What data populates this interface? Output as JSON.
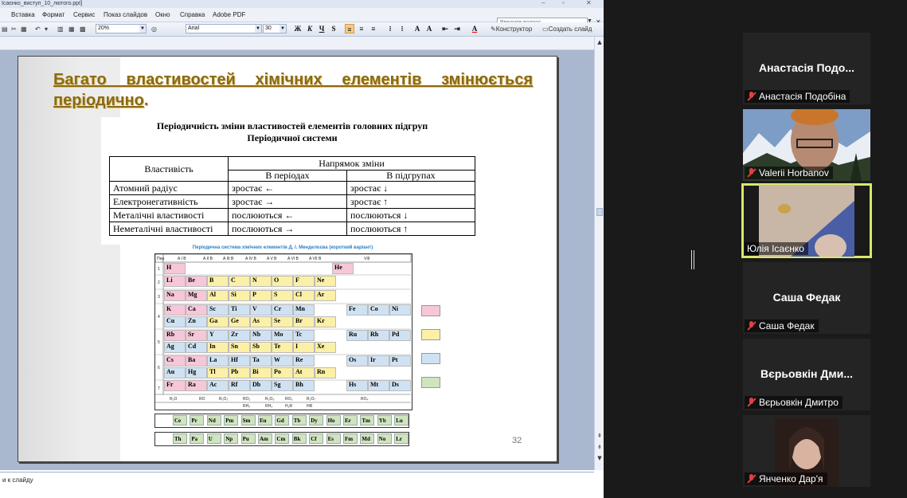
{
  "app": {
    "window_title": "Ісаєнко_виступ_10_лютого.ppt]",
    "menu": [
      "Вставка",
      "Формат",
      "Сервис",
      "Показ слайдов",
      "Окно",
      "Справка",
      "Adobe PDF"
    ],
    "help_placeholder": "Введите вопрос",
    "zoom": "20%",
    "font": "Arial",
    "font_size": "30",
    "constructor_label": "Конструктор",
    "new_slide_label": "Создать слайд",
    "notes_text": "и к слайду"
  },
  "slide": {
    "title_part1": "Багато властивостей хімічних елементів ",
    "title_part2": "змінюється періодично",
    "title_end": ".",
    "table_title_line1": "Періодичність зміни властивостей елементів головних підгруп",
    "table_title_line2": "Періодичної системи",
    "table": {
      "header_property": "Властивість",
      "header_direction": "Напрямок зміни",
      "header_periods": "В періодах",
      "header_groups": "В підгрупах",
      "rows": [
        {
          "property": "Атомний радіус",
          "periods": "зростає ←",
          "groups": "зростає ↓"
        },
        {
          "property": "Електронегативність",
          "periods": "зростає →",
          "groups": "зростає ↑"
        },
        {
          "property": "Металічні властивості",
          "periods": "послюються ←",
          "groups": "послюються ↓"
        },
        {
          "property": "Неметалічні властивості",
          "periods": "послюються →",
          "groups": "послюються ↑"
        }
      ]
    },
    "periodic_title": "Періодична система хімічних елементів Д. І. Менделєєва (короткий варіант)",
    "slide_number": "32"
  },
  "participants": [
    {
      "display": "Анастасія Подо...",
      "name": "Анастасія Подобіна",
      "muted": true,
      "video": false
    },
    {
      "display": "",
      "name": "Valerii Horbanov",
      "muted": true,
      "video": true
    },
    {
      "display": "",
      "name": "Юлія Ісаєнко",
      "muted": false,
      "video": true,
      "speaking": true
    },
    {
      "display": "Саша Федак",
      "name": "Саша Федак",
      "muted": true,
      "video": false
    },
    {
      "display": "Вєрьовкін Дми...",
      "name": "Вєрьовкін Дмитро",
      "muted": true,
      "video": false
    },
    {
      "display": "",
      "name": "Янченко Дар'я",
      "muted": true,
      "video": true
    }
  ]
}
